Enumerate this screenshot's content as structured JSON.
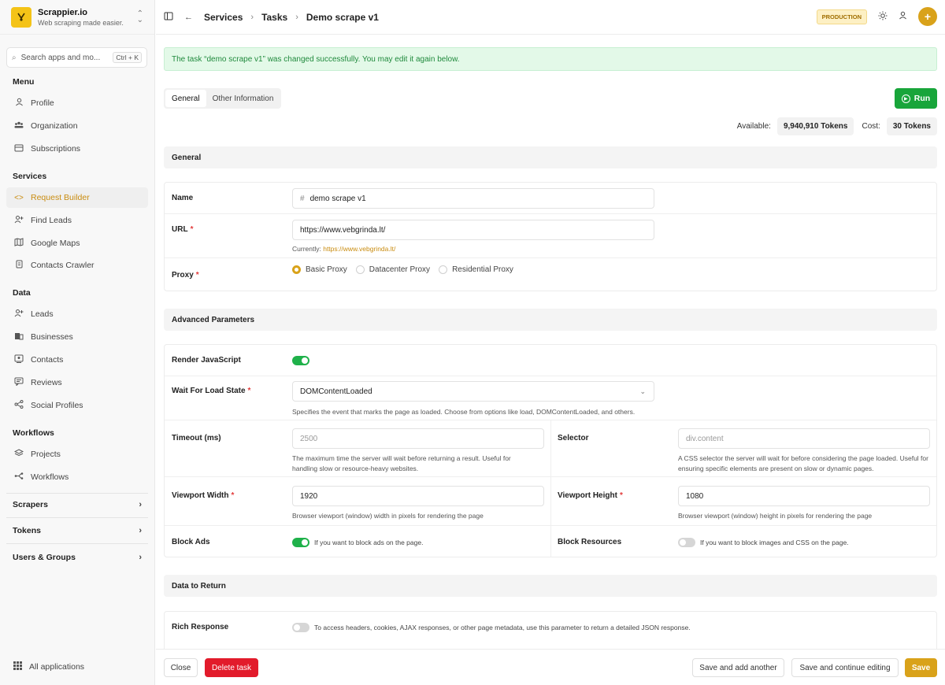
{
  "brand": {
    "name": "Scrappier.io",
    "tagline": "Web scraping made easier.",
    "logo_text": "SCRAPPIER"
  },
  "search": {
    "placeholder": "Search apps and mo...",
    "shortcut": "Ctrl + K"
  },
  "sidebar": {
    "menu_title": "Menu",
    "menu": [
      {
        "label": "Profile",
        "icon": "user-icon"
      },
      {
        "label": "Organization",
        "icon": "users-icon"
      },
      {
        "label": "Subscriptions",
        "icon": "card-icon"
      }
    ],
    "services_title": "Services",
    "services": [
      {
        "label": "Request Builder",
        "icon": "code-icon",
        "active": true
      },
      {
        "label": "Find Leads",
        "icon": "user-plus-icon"
      },
      {
        "label": "Google Maps",
        "icon": "map-icon"
      },
      {
        "label": "Contacts Crawler",
        "icon": "file-icon"
      }
    ],
    "data_title": "Data",
    "data": [
      {
        "label": "Leads",
        "icon": "user-plus-icon"
      },
      {
        "label": "Businesses",
        "icon": "building-icon"
      },
      {
        "label": "Contacts",
        "icon": "contact-icon"
      },
      {
        "label": "Reviews",
        "icon": "review-icon"
      },
      {
        "label": "Social Profiles",
        "icon": "share-icon"
      }
    ],
    "workflows_title": "Workflows",
    "workflows": [
      {
        "label": "Projects",
        "icon": "layers-icon"
      },
      {
        "label": "Workflows",
        "icon": "workflow-icon"
      }
    ],
    "groups": [
      "Scrapers",
      "Tokens",
      "Users & Groups"
    ],
    "all_apps": "All applications"
  },
  "topbar": {
    "breadcrumb": [
      "Services",
      "Tasks",
      "Demo scrape v1"
    ],
    "env_badge": "PRODUCTION"
  },
  "alert": "The task “demo scrape v1” was changed successfully. You may edit it again below.",
  "tabs": [
    "General",
    "Other Information"
  ],
  "run_label": "Run",
  "tokens": {
    "available_label": "Available:",
    "available_value": "9,940,910 Tokens",
    "cost_label": "Cost:",
    "cost_value": "30 Tokens"
  },
  "general": {
    "title": "General",
    "name_label": "Name",
    "name_value": "demo scrape v1",
    "url_label": "URL",
    "url_value": "https://www.vebgrinda.lt/",
    "url_current_prefix": "Currently:",
    "url_current_link": "https://www.vebgrinda.lt/",
    "proxy_label": "Proxy",
    "proxy_options": [
      "Basic Proxy",
      "Datacenter Proxy",
      "Residential Proxy"
    ],
    "proxy_selected": "Basic Proxy"
  },
  "advanced": {
    "title": "Advanced Parameters",
    "render_js_label": "Render JavaScript",
    "render_js_on": true,
    "wait_label": "Wait For Load State",
    "wait_value": "DOMContentLoaded",
    "wait_help": "Specifies the event that marks the page as loaded. Choose from options like load, DOMContentLoaded, and others.",
    "timeout_label": "Timeout (ms)",
    "timeout_placeholder": "2500",
    "timeout_help": "The maximum time the server will wait before returning a result. Useful for handling slow or resource-heavy websites.",
    "selector_label": "Selector",
    "selector_placeholder": "div.content",
    "selector_help": "A CSS selector the server will wait for before considering the page loaded. Useful for ensuring specific elements are present on slow or dynamic pages.",
    "vw_label": "Viewport Width",
    "vw_value": "1920",
    "vw_help": "Browser viewport (window) width in pixels for rendering the page",
    "vh_label": "Viewport Height",
    "vh_value": "1080",
    "vh_help": "Browser viewport (window) height in pixels for rendering the page",
    "block_ads_label": "Block Ads",
    "block_ads_on": true,
    "block_ads_help": "If you want to block ads on the page.",
    "block_res_label": "Block Resources",
    "block_res_on": false,
    "block_res_help": "If you want to block images and CSS on the page."
  },
  "data_return": {
    "title": "Data to Return",
    "rich_label": "Rich Response",
    "rich_on": false,
    "rich_help": "To access headers, cookies, AJAX responses, or other page metadata, use this parameter to return a detailed JSON response."
  },
  "footer": {
    "close": "Close",
    "delete": "Delete task",
    "save_add": "Save and add another",
    "save_continue": "Save and continue editing",
    "save": "Save"
  },
  "colors": {
    "accent": "#d9a21a",
    "success": "#18a53a",
    "danger": "#e21b2b"
  }
}
